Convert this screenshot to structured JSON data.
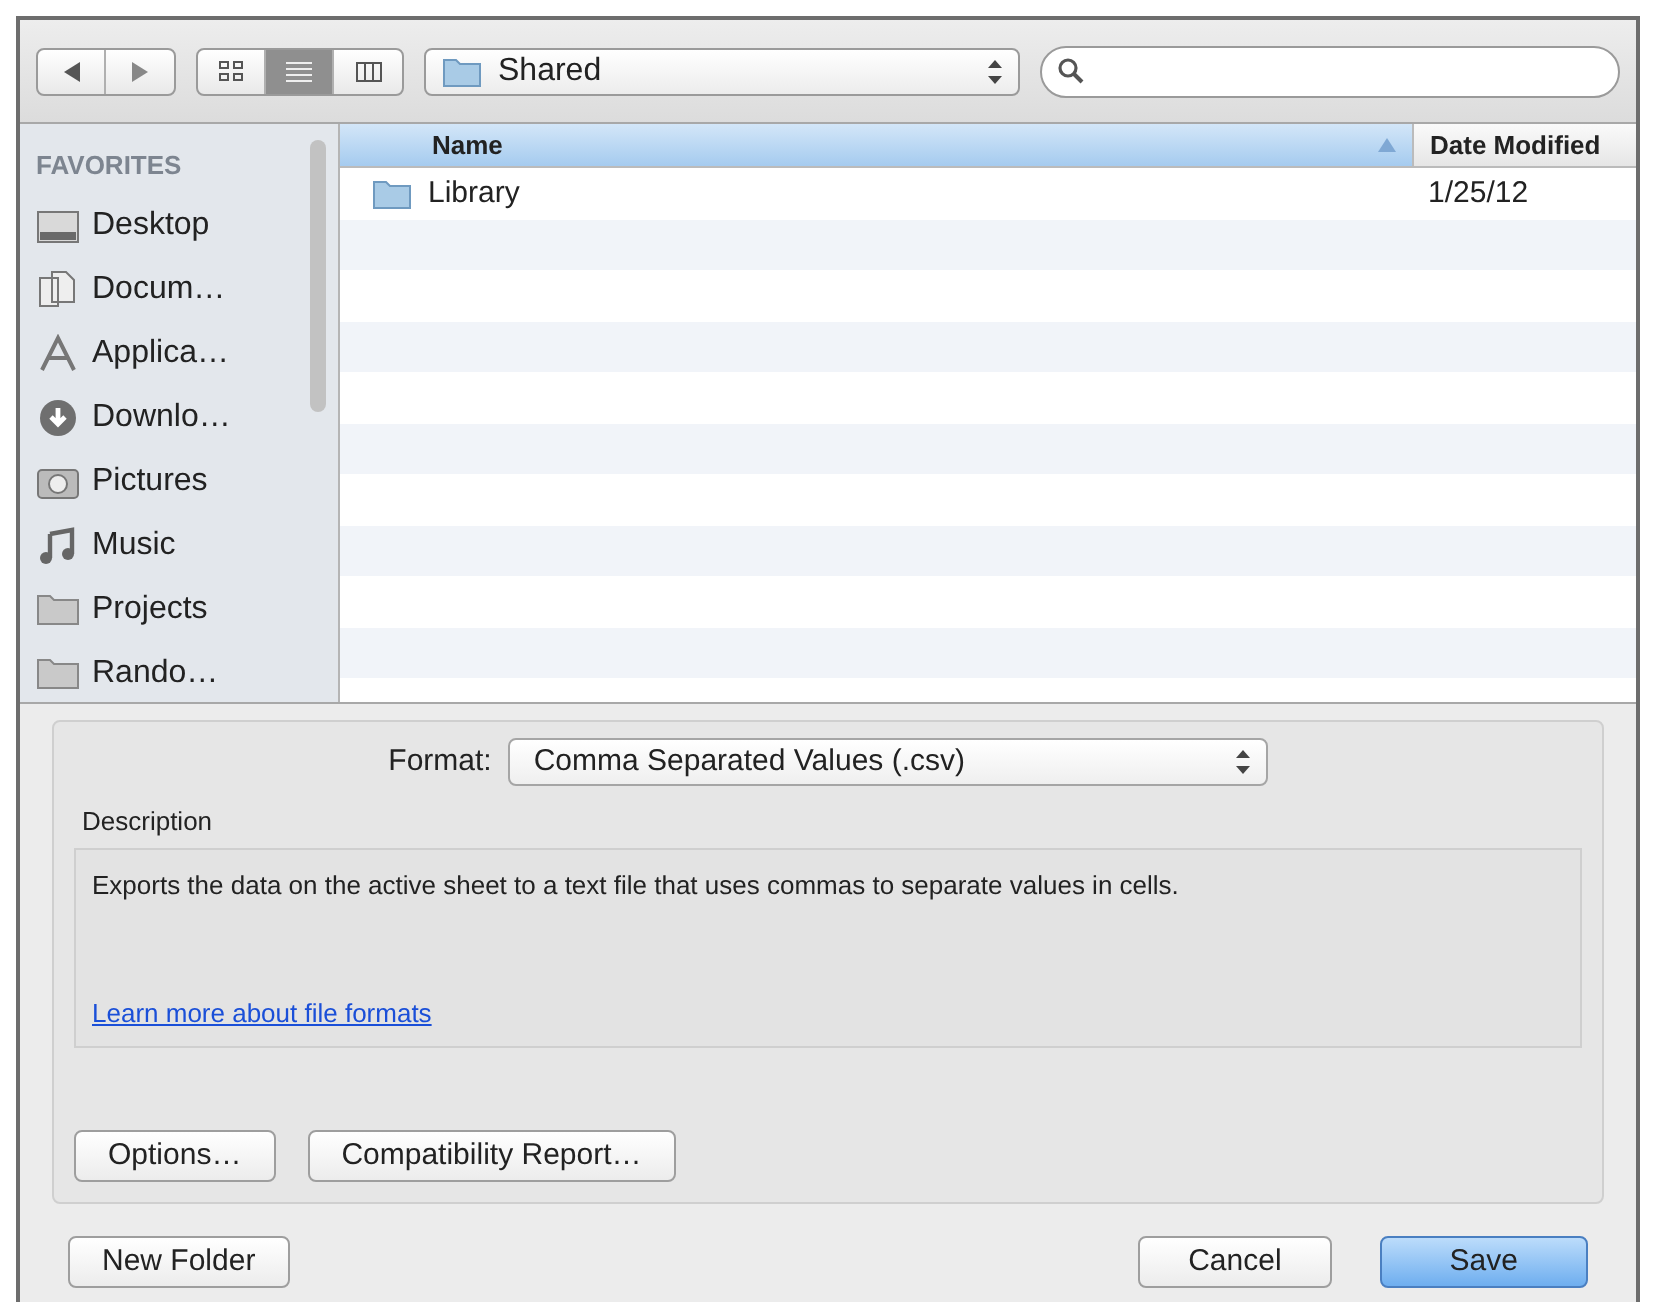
{
  "toolbar": {
    "view_buttons": [
      {
        "kind": "icons",
        "selected": false
      },
      {
        "kind": "list",
        "selected": true
      },
      {
        "kind": "columns",
        "selected": false
      }
    ],
    "location": "Shared"
  },
  "sidebar": {
    "heading": "FAVORITES",
    "items": [
      {
        "label": "Desktop",
        "kind": "desktop"
      },
      {
        "label": "Docum…",
        "kind": "documents"
      },
      {
        "label": "Applica…",
        "kind": "applications"
      },
      {
        "label": "Downlo…",
        "kind": "downloads"
      },
      {
        "label": "Pictures",
        "kind": "pictures"
      },
      {
        "label": "Music",
        "kind": "music"
      },
      {
        "label": "Projects",
        "kind": "folder"
      },
      {
        "label": "Rando…",
        "kind": "folder"
      }
    ]
  },
  "table": {
    "columns": [
      {
        "label": "Name",
        "sorted": true
      },
      {
        "label": "Date Modified",
        "sorted": false
      }
    ],
    "rows": [
      {
        "name": "Library",
        "date": "1/25/12"
      }
    ]
  },
  "format": {
    "label": "Format:",
    "value": "Comma Separated Values (.csv)"
  },
  "description": {
    "heading": "Description",
    "text": "Exports the data on the active sheet to a text file that uses commas to separate values in cells.",
    "link": "Learn more about file formats"
  },
  "panel_buttons": [
    "Options…",
    "Compatibility Report…"
  ],
  "footer": {
    "new_folder": "New Folder",
    "cancel": "Cancel",
    "save": "Save"
  }
}
